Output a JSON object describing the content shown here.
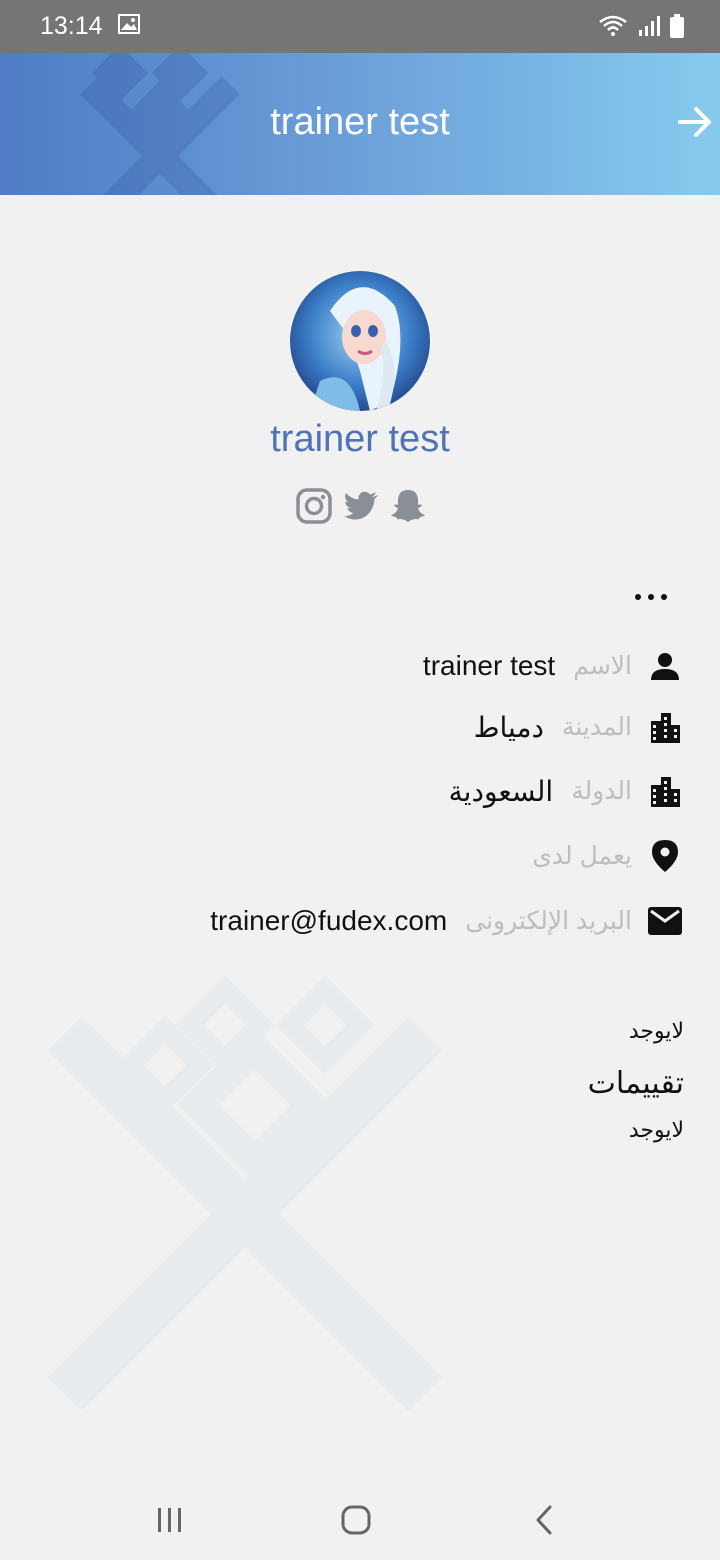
{
  "status_bar": {
    "time": "13:14"
  },
  "header": {
    "title": "trainer test"
  },
  "profile": {
    "name": "trainer test"
  },
  "info": {
    "name_label": "الاسم",
    "name_value": "trainer test",
    "city_label": "المدينة",
    "city_value": "دمياط",
    "country_label": "الدولة",
    "country_value": "السعودية",
    "works_at_label": "يعمل لدى",
    "email_label": "البريد الإلكترونى",
    "email_value": "trainer@fudex.com"
  },
  "bio_text": "لايوجد",
  "ratings": {
    "title": "تقييمات",
    "empty_text": "لايوجد"
  },
  "colors": {
    "header_start": "#4f7cc4",
    "header_end": "#86cbee",
    "name_blue": "#4f73b6",
    "label_gray": "#bdbdbd"
  }
}
